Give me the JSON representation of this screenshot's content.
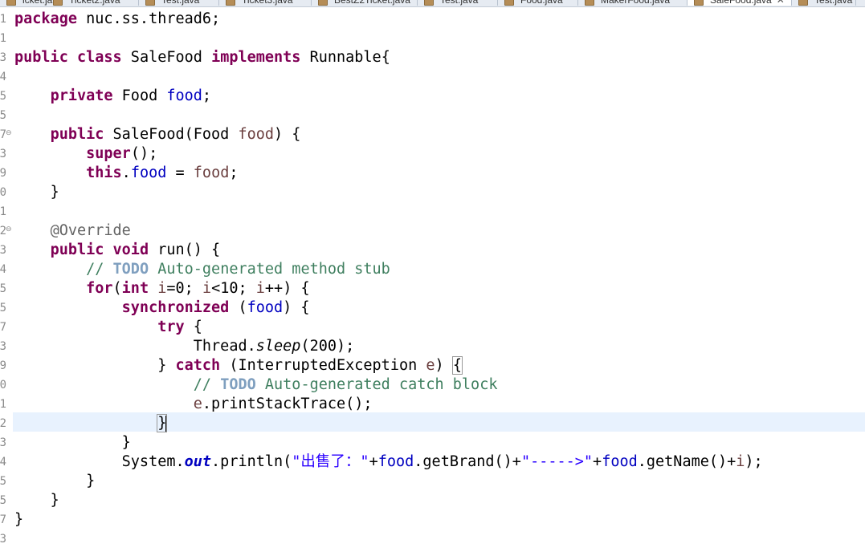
{
  "tabs": [
    {
      "label": "icket.java"
    },
    {
      "label": "Ticket2.java"
    },
    {
      "label": "Test.java"
    },
    {
      "label": "Ticket3.java"
    },
    {
      "label": "BestZ2Ticket.java"
    },
    {
      "label": "Test.java"
    },
    {
      "label": "Food.java"
    },
    {
      "label": "MakerFood.java"
    },
    {
      "label": "SaleFood.java",
      "active": true
    },
    {
      "label": "Test.java"
    }
  ],
  "gutter": [
    "1",
    "1",
    "3",
    "4",
    "5",
    "5",
    "7",
    "3",
    "9",
    "0",
    "1",
    "2",
    "3",
    "4",
    "5",
    "5",
    "7",
    "3",
    "9",
    "0",
    "1",
    "2",
    "3",
    "4",
    "5",
    "5",
    "7",
    "3"
  ],
  "code": {
    "l1": {
      "kw": "package",
      "rest": " nuc.ss.thread6;"
    },
    "l3": {
      "k1": "public",
      "k2": "class",
      "name": " SaleFood ",
      "k3": "implements",
      "rest": " Runnable{"
    },
    "l5": {
      "kw": "private",
      "type": " Food ",
      "fld": "food",
      "end": ";"
    },
    "l7": {
      "kw": "public",
      "sig": " SaleFood(Food ",
      "param": "food",
      "end": ") {"
    },
    "l8": {
      "kw": "super",
      "end": "();"
    },
    "l9": {
      "kw": "this",
      "dot": ".",
      "fld": "food",
      "eq": " = ",
      "var": "food",
      "end": ";"
    },
    "l10": {
      "text": "}"
    },
    "l12": {
      "ann": "@Override"
    },
    "l13": {
      "k1": "public",
      "k2": "void",
      "rest": " run() {"
    },
    "l14": {
      "pre": "// ",
      "todo": "TODO",
      "rest": " Auto-generated method stub"
    },
    "l15": {
      "kw": "for",
      "p1": "(",
      "kw2": "int",
      "v1": " i",
      "p2": "=0; ",
      "v2": "i",
      "p3": "<10; ",
      "v3": "i",
      "p4": "++) {"
    },
    "l16": {
      "kw": "synchronized",
      "p1": " (",
      "fld": "food",
      "p2": ") {"
    },
    "l17": {
      "kw": "try",
      "end": " {"
    },
    "l18": {
      "cls": "Thread.",
      "m": "sleep",
      "end": "(200);"
    },
    "l19": {
      "pre": "} ",
      "kw": "catch",
      "p1": " (InterruptedException ",
      "var": "e",
      "p2": ") ",
      "br": "{"
    },
    "l20": {
      "pre": "// ",
      "todo": "TODO",
      "rest": " Auto-generated catch block"
    },
    "l21": {
      "var": "e",
      "rest": ".printStackTrace();"
    },
    "l22": {
      "text": "}"
    },
    "l23": {
      "text": "}"
    },
    "l24": {
      "cls": "System.",
      "sf": "out",
      "m": ".println(",
      "s1": "\"出售了：\"",
      "p1": "+",
      "f1": "food",
      "p2": ".getBrand()+",
      "s2": "\"----->\"",
      "p3": "+",
      "f2": "food",
      "p4": ".getName()+",
      "v": "i",
      "end": ");"
    },
    "l25": {
      "text": "}"
    },
    "l26": {
      "text": "}"
    },
    "l27": {
      "text": "}"
    }
  }
}
